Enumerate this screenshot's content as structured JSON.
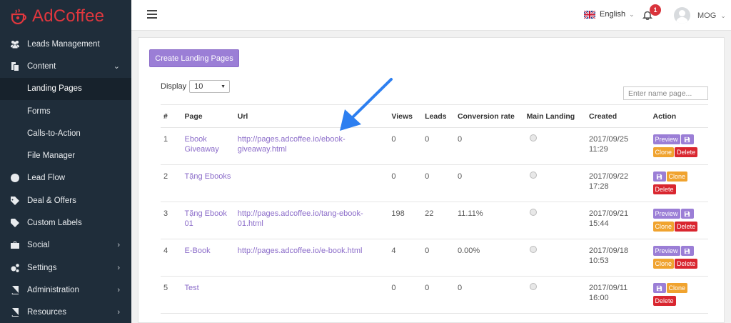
{
  "brand": {
    "name": "AdCoffee",
    "color": "#e0373e"
  },
  "sidebar": {
    "items": [
      {
        "label": "Leads Management",
        "icon": "users-icon",
        "chevron": ""
      },
      {
        "label": "Content",
        "icon": "files-icon",
        "chevron": "⌄"
      },
      {
        "label": "Landing Pages",
        "sub": true,
        "active": true
      },
      {
        "label": "Forms",
        "sub": true
      },
      {
        "label": "Calls-to-Action",
        "sub": true
      },
      {
        "label": "File Manager",
        "sub": true
      },
      {
        "label": "Lead Flow",
        "icon": "circle-icon",
        "chevron": ""
      },
      {
        "label": "Deal & Offers",
        "icon": "tag-icon",
        "chevron": ""
      },
      {
        "label": "Custom Labels",
        "icon": "label-icon",
        "chevron": ""
      },
      {
        "label": "Social",
        "icon": "briefcase-icon",
        "chevron": "›"
      },
      {
        "label": "Settings",
        "icon": "cogs-icon",
        "chevron": "›"
      },
      {
        "label": "Administration",
        "icon": "book-icon",
        "chevron": "›"
      },
      {
        "label": "Resources",
        "icon": "book-icon",
        "chevron": "›"
      }
    ]
  },
  "topbar": {
    "language": "English",
    "notifications": "1",
    "user": "MOG"
  },
  "main": {
    "create_button": "Create Landing Pages",
    "display_label": "Display",
    "display_value": "10",
    "search_placeholder": "Enter name page...",
    "columns": [
      "#",
      "Page",
      "Url",
      "Views",
      "Leads",
      "Conversion rate",
      "Main Landing",
      "Created",
      "Action"
    ],
    "rows": [
      {
        "num": "1",
        "page": "Ebook Giveaway",
        "url": "http://pages.adcoffee.io/ebook-giveaway.html",
        "views": "0",
        "leads": "0",
        "conv": "0",
        "created": "2017/09/25 11:29",
        "actions": [
          "Preview",
          "save",
          "Clone",
          "Delete"
        ]
      },
      {
        "num": "2",
        "page": "Tặng Ebooks",
        "url": "",
        "views": "0",
        "leads": "0",
        "conv": "0",
        "created": "2017/09/22 17:28",
        "actions": [
          "save",
          "Clone",
          "Delete"
        ]
      },
      {
        "num": "3",
        "page": "Tặng Ebook 01",
        "url": "http://pages.adcoffee.io/tang-ebook-01.html",
        "views": "198",
        "leads": "22",
        "conv": "11.11%",
        "created": "2017/09/21 15:44",
        "actions": [
          "Preview",
          "save",
          "Clone",
          "Delete"
        ]
      },
      {
        "num": "4",
        "page": "E-Book",
        "url": "http://pages.adcoffee.io/e-book.html",
        "views": "4",
        "leads": "0",
        "conv": "0.00%",
        "created": "2017/09/18 10:53",
        "actions": [
          "Preview",
          "save",
          "Clone",
          "Delete"
        ]
      },
      {
        "num": "5",
        "page": "Test",
        "url": "",
        "views": "0",
        "leads": "0",
        "conv": "0",
        "created": "2017/09/11 16:00",
        "actions": [
          "save",
          "Clone",
          "Delete"
        ]
      }
    ]
  },
  "colors": {
    "accent": "#9b7ed6",
    "clone": "#f0a32f",
    "delete": "#d9262f",
    "sidebar": "#1f2d3a",
    "annotation_arrow": "#2d7ff0"
  }
}
